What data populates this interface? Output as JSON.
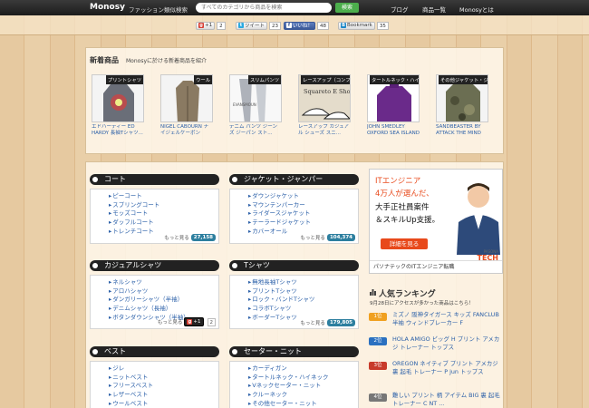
{
  "header": {
    "logo": "Monosy",
    "tagline": "ファッション類似検索",
    "search_placeholder": "すべてのカテゴリから商品を検索",
    "search_button": "検索",
    "nav": [
      "ブログ",
      "商品一覧",
      "Monosyとは"
    ]
  },
  "share": {
    "gplus": {
      "label": "+1",
      "count": "2"
    },
    "twitter": {
      "label": "ツイート",
      "count": "23"
    },
    "facebook": {
      "label": "いいね！",
      "count": "48"
    },
    "hatena": {
      "label": "Bookmark",
      "count": "35"
    }
  },
  "new_items": {
    "title": "新着商品",
    "subtitle": "Monosyに於ける新着商品を紹介",
    "items": [
      {
        "ribbon": "プリントシャツ",
        "name": "エドハーディー ED HARDY 長袖Tシャツ...",
        "color": "#6a6e78"
      },
      {
        "ribbon": "ウール",
        "name": "NIGEL CABOURN ナイジェルケーボン",
        "color": "#8a7a62"
      },
      {
        "ribbon": "スリムパンツ",
        "name": "デニム パンツ ジーンズ ジーパン スト...",
        "color": "#d8d8dc"
      },
      {
        "ribbon": "レースアップ（コンフォート）",
        "name": "レースアップ カジュアル シューズ スニ...",
        "color": "#c9c0a8"
      },
      {
        "ribbon": "タートルネック・ハイネック",
        "name": "JOHN SMEDLEY OXFORD SEA ISLAND",
        "color": "#6a2a8a"
      },
      {
        "ribbon": "その他ジャケット・ジャンパー",
        "name": "SANDBEASTER BY ATTACK THE MIND",
        "color": "#6b6e52"
      }
    ],
    "thumb_text": {
      "evans": "EVANSMOUN",
      "shoes": "Squareto E Shoes"
    }
  },
  "categories": [
    {
      "title": "コート",
      "items": [
        "ピーコート",
        "スプリングコート",
        "モッズコート",
        "ダッフルコート",
        "トレンチコート"
      ],
      "more": "もっと見る",
      "count": "27,158"
    },
    {
      "title": "ジャケット・ジャンパー",
      "items": [
        "ダウンジャケット",
        "マウンテンパーカー",
        "ライダースジャケット",
        "テーラードジャケット",
        "カバーオール"
      ],
      "more": "もっと見る",
      "count": "104,374"
    },
    {
      "title": "カジュアルシャツ",
      "items": [
        "ネルシャツ",
        "アロハシャツ",
        "ダンガリーシャツ（半袖）",
        "デニムシャツ（長袖）",
        "ボタンダウンシャツ（半袖）"
      ],
      "more": "もっと見る",
      "count": "+1"
    },
    {
      "title": "Tシャツ",
      "items": [
        "無地長袖Tシャツ",
        "プリントTシャツ",
        "ロック・バンドTシャツ",
        "コラボTシャツ",
        "ボーダーTシャツ"
      ],
      "more": "もっと見る",
      "count": "179,805"
    },
    {
      "title": "ベスト",
      "items": [
        "ジレ",
        "ニットベスト",
        "フリースベスト",
        "レザーベスト",
        "ウールベスト"
      ]
    },
    {
      "title": "セーター・ニット",
      "items": [
        "カーディガン",
        "タートルネック・ハイネック",
        "Vネックセーター・ニット",
        "クルーネック",
        "その他セーター・ニット"
      ]
    }
  ],
  "popup": {
    "label": "+1",
    "count": "2"
  },
  "ad": {
    "line1": "ITエンジニア",
    "line2": "4万人が選んだ、",
    "line3": "大手正社員案件",
    "line4": "＆スキルUp支援。",
    "button": "詳細を見る",
    "brand_small": "PASONA",
    "brand_big": "TECH",
    "caption": "パソナテックのITエンジニア転職"
  },
  "ranking": {
    "title": "人気ランキング",
    "subtitle": "9月28日にアクセスが多かった商品はこちら！",
    "items": [
      {
        "rank": "1位",
        "text": "ミズノ 阪神タイガース キッズ FANCLUB 半袖 ウィンドブレーカー F",
        "color": "#f0a020"
      },
      {
        "rank": "2位",
        "text": "HOLA AMIGO ビッグ H プリント アメカジ トレーナー トップス",
        "color": "#2a70c0"
      },
      {
        "rank": "3位",
        "text": "OREGON ネイティブ プリント アメカジ 裏 起毛 トレーナー P jun トップス",
        "color": "#c83a2a"
      },
      {
        "rank": "4位",
        "text": "難しい プリント 柄 アイテム BIG 裏 起毛 トレーナー C NT ...",
        "color": "#777"
      }
    ]
  }
}
